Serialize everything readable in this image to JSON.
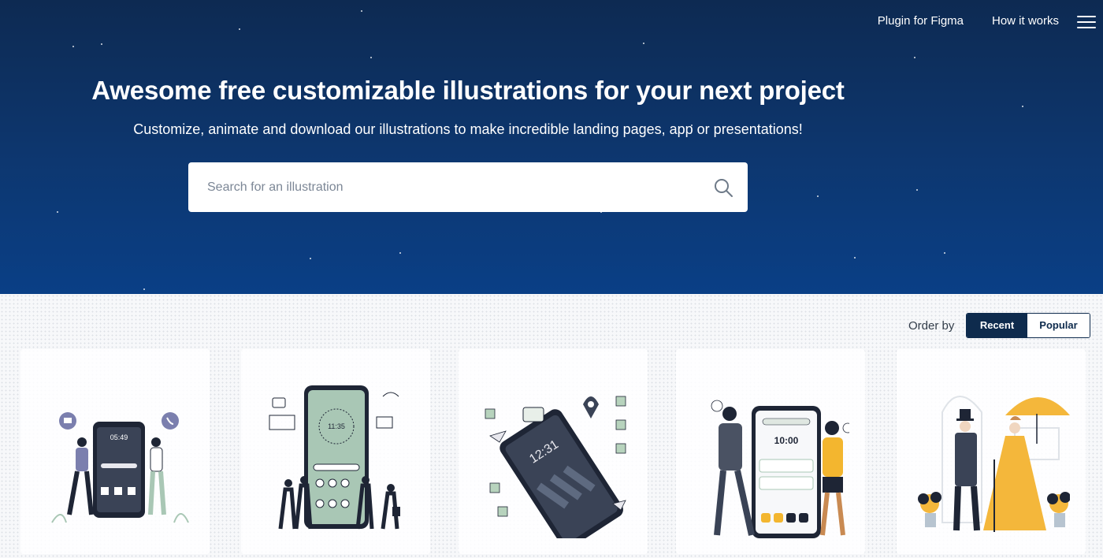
{
  "nav": {
    "plugin_label": "Plugin for Figma",
    "how_label": "How it works",
    "menu_icon": "hamburger-menu-icon"
  },
  "hero": {
    "title": "Awesome free customizable illustrations for your next project",
    "subtitle": "Customize, animate and download our illustrations to make incredible landing pages, app or presentations!"
  },
  "search": {
    "placeholder": "Search for an illustration",
    "icon": "search-icon"
  },
  "order": {
    "label": "Order by",
    "options": [
      "Recent",
      "Popular"
    ],
    "selected": "Recent"
  },
  "illustrations": [
    {
      "time": "05:49",
      "accent": "#7b7fae"
    },
    {
      "time": "11:35",
      "accent": "#a9c7b5"
    },
    {
      "time": "12:31",
      "accent": "#b7d3bd"
    },
    {
      "time": "10:00",
      "accent": "#f3b62f"
    },
    {
      "accent": "#f4b73b"
    }
  ],
  "colors": {
    "hero_top": "#0d2a52",
    "hero_bottom": "#0a3f86",
    "dark": "#0e2b4d",
    "yellow": "#f4b73b"
  }
}
